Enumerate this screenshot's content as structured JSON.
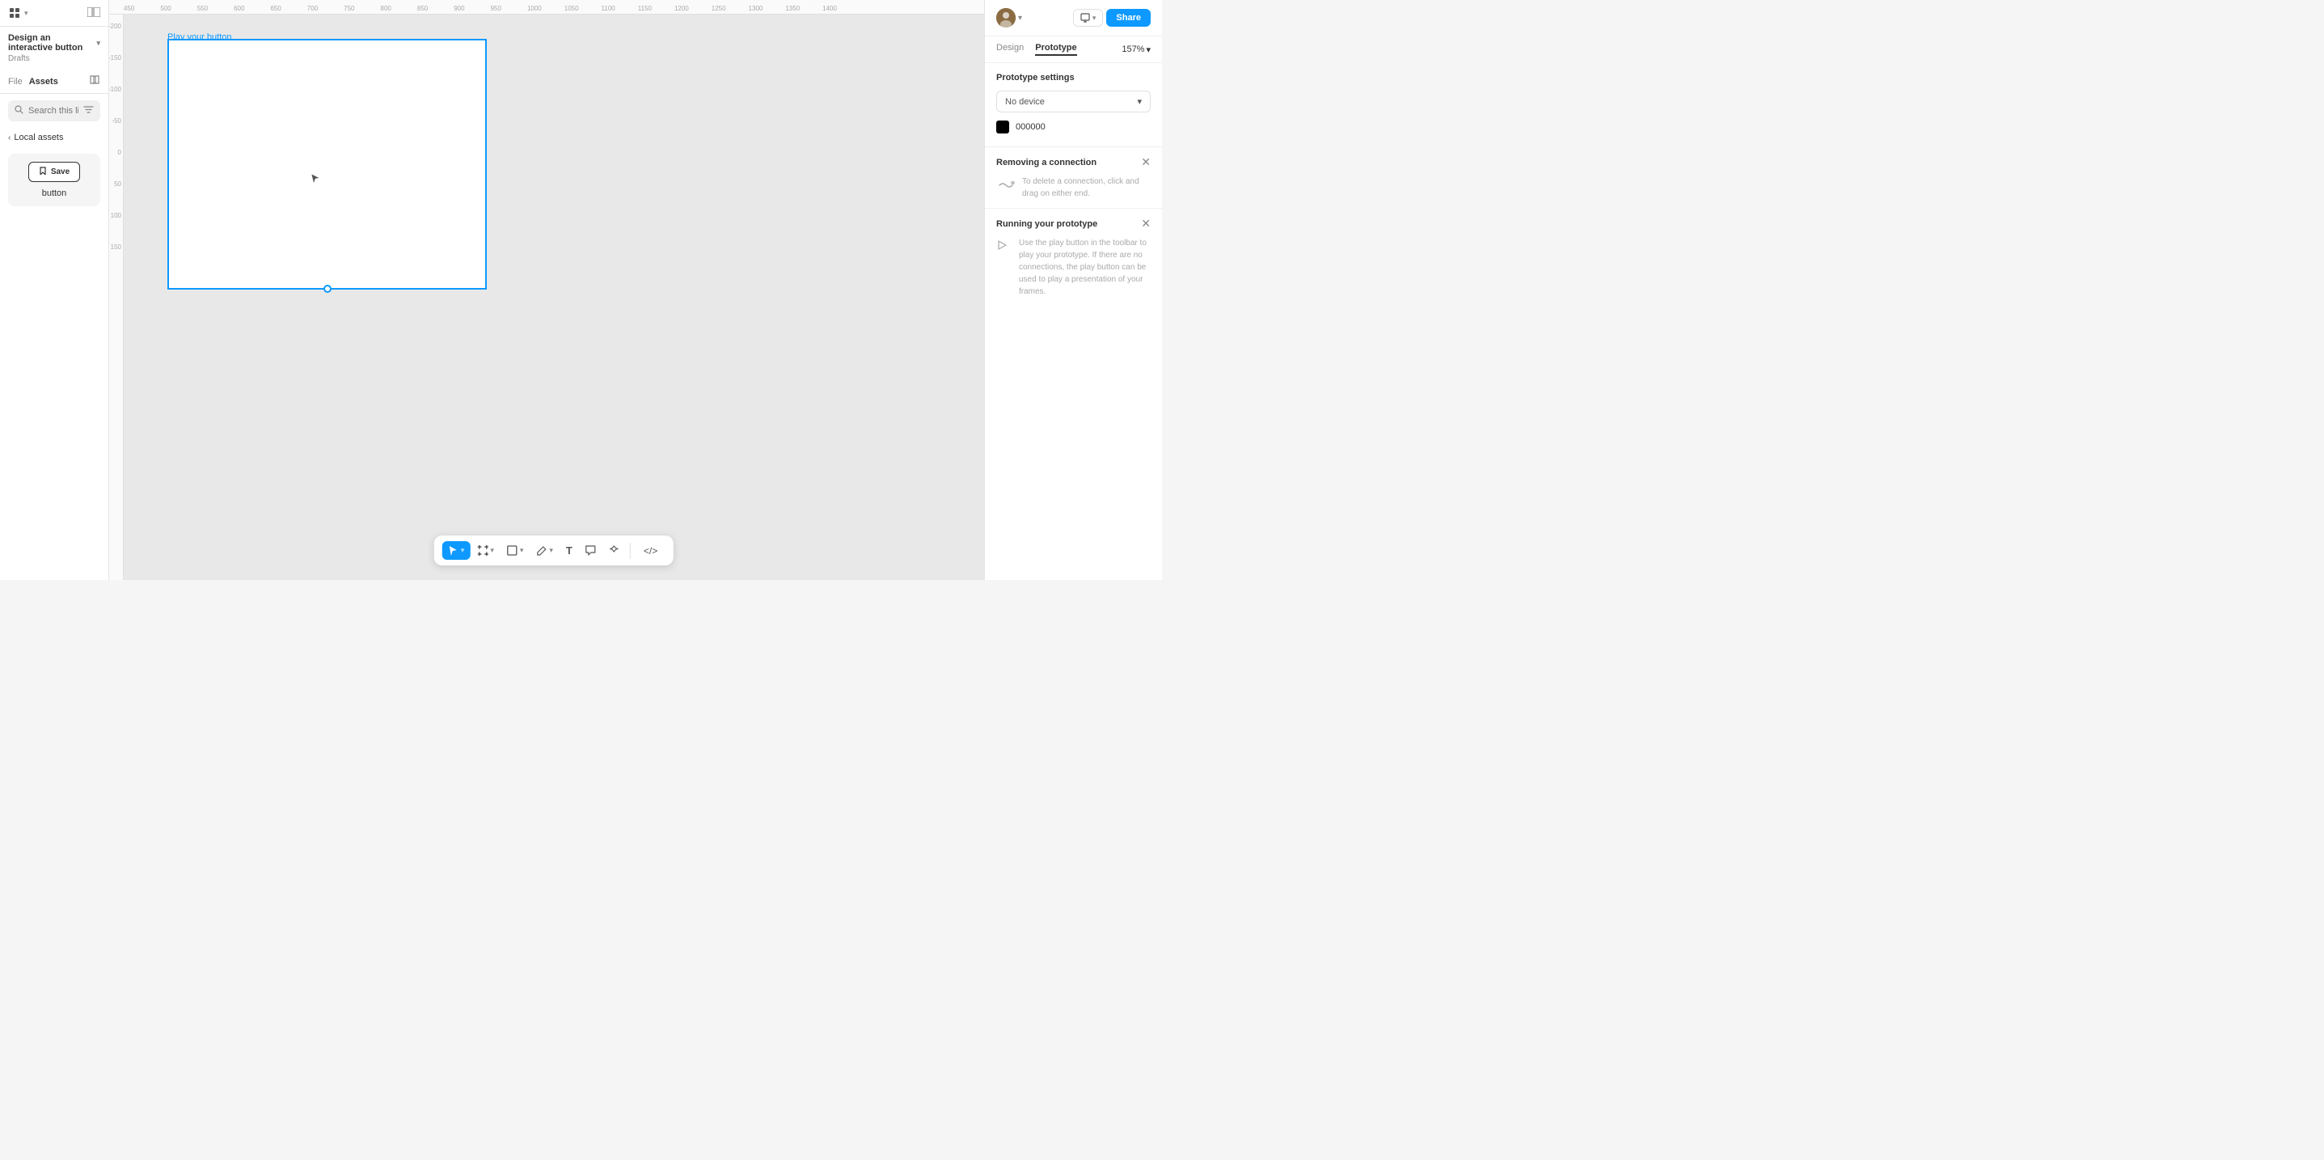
{
  "leftPanel": {
    "componentIcon": "⊞",
    "layoutIcon": "▣",
    "projectTitle": "Design an interactive button",
    "projectTitleDropdown": "▾",
    "projectSubtitle": "Drafts",
    "tabs": [
      {
        "label": "File",
        "active": false
      },
      {
        "label": "Assets",
        "active": true
      }
    ],
    "bookIcon": "📖",
    "searchPlaceholder": "Search this library",
    "filterIcon": "⇅",
    "localAssetsLabel": "Local assets",
    "assetButtonLabel": "Save",
    "assetLabel": "button"
  },
  "canvas": {
    "frameName": "Play your button",
    "rulerMarks": [
      "450",
      "500",
      "550",
      "600",
      "650",
      "700",
      "750",
      "800",
      "850",
      "900",
      "950",
      "1000",
      "1050",
      "1100",
      "1150",
      "1200",
      "1250",
      "1300",
      "1350",
      "1400"
    ],
    "rulerLeftMarks": [
      "-200",
      "-150",
      "-100",
      "-50",
      "0",
      "50",
      "100",
      "150"
    ]
  },
  "toolbar": {
    "selectLabel": "▶",
    "frameLabel": "#",
    "shapeLabel": "⬜",
    "penLabel": "✏",
    "textLabel": "T",
    "commentLabel": "💬",
    "componentLabel": "✦",
    "codeLabel": "</>",
    "activeToolIndex": 0
  },
  "rightPanel": {
    "userName": "U",
    "chevronDown": "▾",
    "presentIcon": "▶",
    "shareLabel": "Share",
    "tabs": [
      {
        "label": "Design",
        "active": false
      },
      {
        "label": "Prototype",
        "active": true
      }
    ],
    "zoomValue": "157%",
    "zoomChevron": "▾",
    "protoSettings": {
      "title": "Prototype settings",
      "deviceLabel": "No device",
      "deviceChevron": "▾",
      "bgColorHex": "000000"
    },
    "removingConnection": {
      "title": "Removing a connection",
      "closeIcon": "✕",
      "infoText": "To delete a connection, click and drag on either end."
    },
    "runningPrototype": {
      "title": "Running your prototype",
      "closeIcon": "✕",
      "runningText": "Use the play button in the toolbar to play your prototype. If there are no connections, the play button can be used to play a presentation of your frames."
    }
  }
}
